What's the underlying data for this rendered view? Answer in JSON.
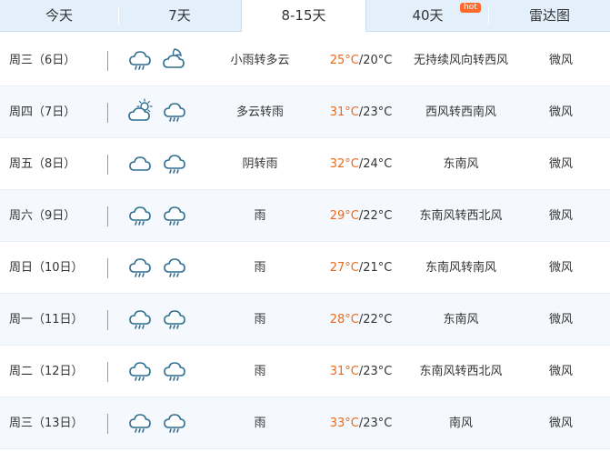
{
  "tabs": [
    {
      "label": "今天"
    },
    {
      "label": "7天"
    },
    {
      "label": "8-15天"
    },
    {
      "label": "40天"
    },
    {
      "label": "雷达图"
    }
  ],
  "hot_badge": "hot",
  "colors": {
    "tab_bg": "#e3f0fb",
    "active_tab_bg": "#ffffff",
    "high_temp": "#ec6a1c",
    "hot_badge": "#ff6a2b"
  },
  "days": [
    {
      "day": "周三（6日）",
      "icons": [
        "rain-cloud-icon",
        "cloud-moon-icon"
      ],
      "desc": "小雨转多云",
      "high": "25°C",
      "low": "/20°C",
      "wind": "无持续风向转西风",
      "level": "微风"
    },
    {
      "day": "周四（7日）",
      "icons": [
        "sun-cloud-icon",
        "rain-cloud-icon"
      ],
      "desc": "多云转雨",
      "high": "31°C",
      "low": "/23°C",
      "wind": "西风转西南风",
      "level": "微风"
    },
    {
      "day": "周五（8日）",
      "icons": [
        "overcast-icon",
        "rain-cloud-icon"
      ],
      "desc": "阴转雨",
      "high": "32°C",
      "low": "/24°C",
      "wind": "东南风",
      "level": "微风"
    },
    {
      "day": "周六（9日）",
      "icons": [
        "rain-cloud-icon",
        "rain-cloud-icon"
      ],
      "desc": "雨",
      "high": "29°C",
      "low": "/22°C",
      "wind": "东南风转西北风",
      "level": "微风"
    },
    {
      "day": "周日（10日）",
      "icons": [
        "rain-cloud-icon",
        "rain-cloud-icon"
      ],
      "desc": "雨",
      "high": "27°C",
      "low": "/21°C",
      "wind": "东南风转南风",
      "level": "微风"
    },
    {
      "day": "周一（11日）",
      "icons": [
        "rain-cloud-icon",
        "rain-cloud-icon"
      ],
      "desc": "雨",
      "high": "28°C",
      "low": "/22°C",
      "wind": "东南风",
      "level": "微风"
    },
    {
      "day": "周二（12日）",
      "icons": [
        "rain-cloud-icon",
        "rain-cloud-icon"
      ],
      "desc": "雨",
      "high": "31°C",
      "low": "/23°C",
      "wind": "东南风转西北风",
      "level": "微风"
    },
    {
      "day": "周三（13日）",
      "icons": [
        "rain-cloud-icon",
        "rain-cloud-icon"
      ],
      "desc": "雨",
      "high": "33°C",
      "low": "/23°C",
      "wind": "南风",
      "level": "微风"
    }
  ]
}
